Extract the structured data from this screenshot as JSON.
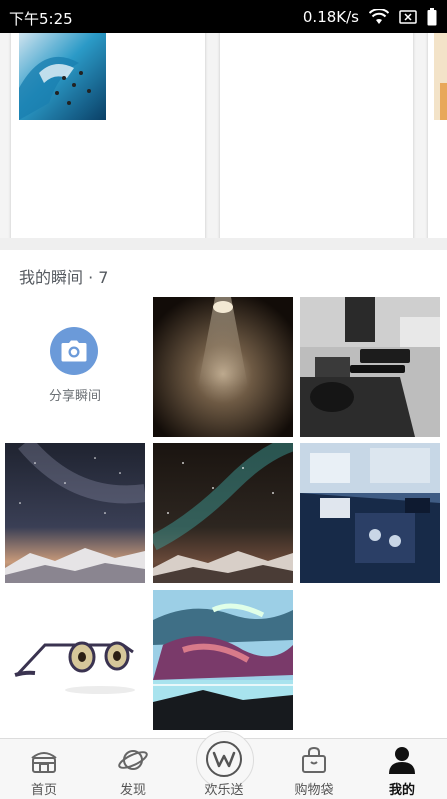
{
  "status_bar": {
    "time": "下午5:25",
    "network_speed": "0.18K/s"
  },
  "moments": {
    "title": "我的瞬间 · 7",
    "share_label": "分享瞬间"
  },
  "bottom_nav": {
    "items": [
      {
        "label": "首页",
        "icon": "home-icon"
      },
      {
        "label": "发现",
        "icon": "planet-icon"
      },
      {
        "label": "欢乐送",
        "icon": "w-logo-icon"
      },
      {
        "label": "购物袋",
        "icon": "shopping-bag-icon"
      },
      {
        "label": "我的",
        "icon": "person-icon",
        "active": true
      }
    ]
  },
  "colors": {
    "accent": "#6b9ad9",
    "status_bar": "#000000"
  }
}
